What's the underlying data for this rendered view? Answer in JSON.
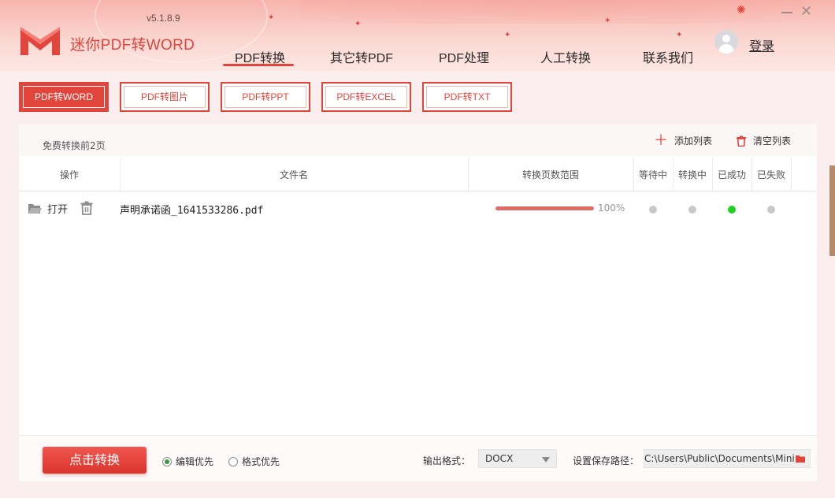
{
  "app": {
    "name": "迷你PDF转WORD",
    "version": "v5.1.8.9",
    "login": "登录",
    "accent": "#e2453c"
  },
  "nav": {
    "items": [
      "PDF转换",
      "其它转PDF",
      "PDF处理",
      "人工转换",
      "联系我们"
    ],
    "active": "PDF转换"
  },
  "subtabs": {
    "items": [
      "PDF转WORD",
      "PDF转图片",
      "PDF转PPT",
      "PDF转EXCEL",
      "PDF转TXT"
    ],
    "active": "PDF转WORD"
  },
  "panel": {
    "free_note": "免费转换前2页",
    "add_list": "添加列表",
    "clear_list": "清空列表"
  },
  "table": {
    "headers": {
      "op": "操作",
      "filename": "文件名",
      "range": "转换页数范围",
      "waiting": "等待中",
      "converting": "转换中",
      "success": "已成功",
      "failed": "已失败"
    },
    "rows": [
      {
        "open": "打开",
        "filename": "声明承诺函_1641533286.pdf",
        "progress": 100,
        "progress_text": "100%",
        "status": "success"
      }
    ]
  },
  "bottom": {
    "convert_button": "点击转换",
    "radio_edit": "编辑优先",
    "radio_format": "格式优先",
    "radio_selected": "编辑优先",
    "output_format_label": "输出格式：",
    "output_format_value": "DOCX",
    "save_path_label": "设置保存路径：",
    "save_path_value": "C:\\Users\\Public\\Documents\\Mini"
  },
  "icons": {
    "logo": "m-logo",
    "avatar": "user-avatar",
    "minimize": "minimize-icon",
    "close": "close-icon",
    "plus": "plus-icon",
    "trash": "trash-icon",
    "folder": "folder-icon"
  }
}
